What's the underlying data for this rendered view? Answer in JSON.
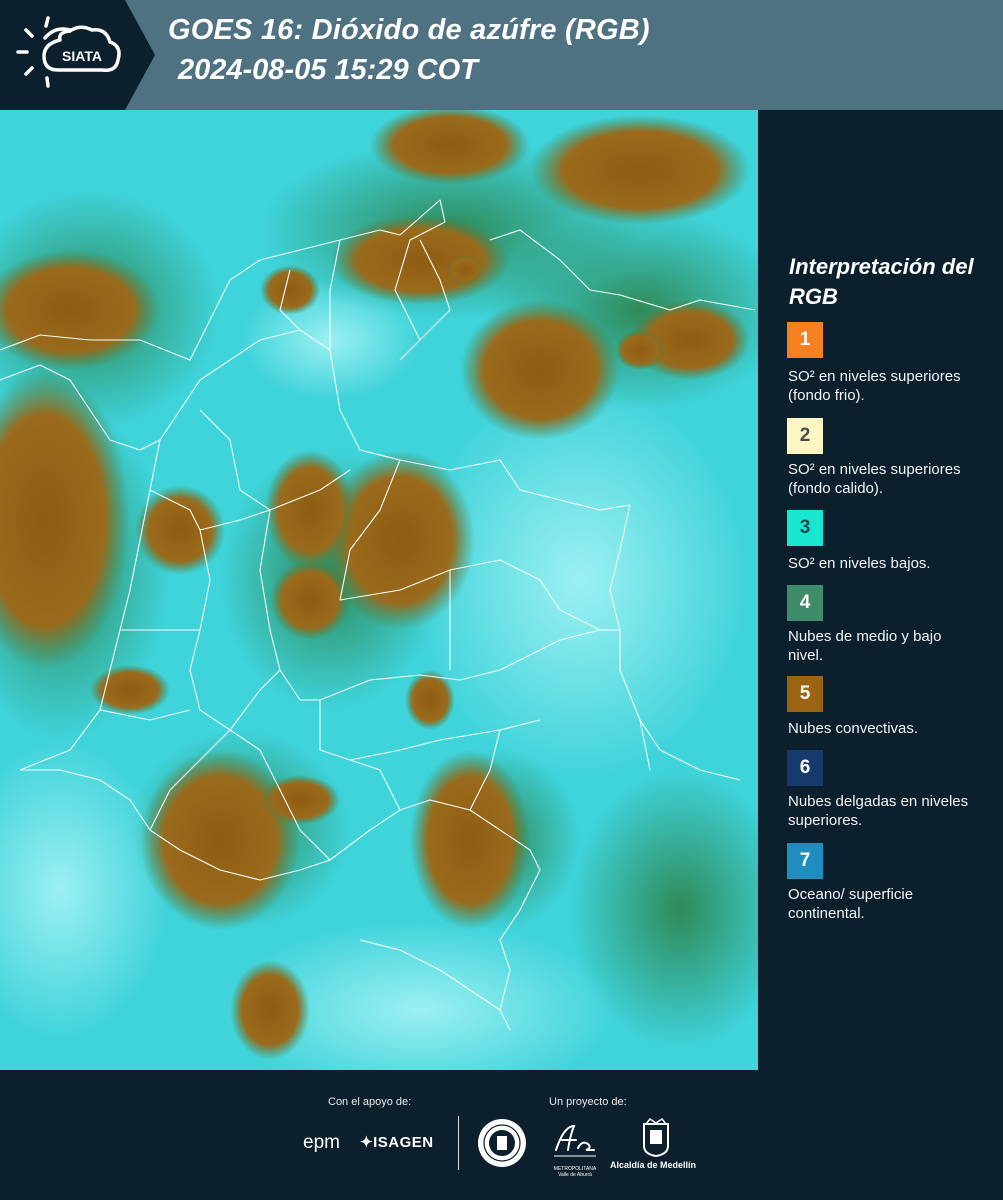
{
  "header": {
    "logo_text": "SIATA",
    "title": "GOES 16: Dióxido de azúfre (RGB)",
    "datetime": "2024-08-05 15:29 COT"
  },
  "legend": {
    "title": "Interpretación del RGB",
    "items": [
      {
        "number": "1",
        "color": "#f5801f",
        "text_color": "#ffffff",
        "label": "SO² en niveles superiores (fondo frio)."
      },
      {
        "number": "2",
        "color": "#fdf6c3",
        "text_color": "#4a4a4a",
        "label": "SO² en niveles superiores (fondo calido)."
      },
      {
        "number": "3",
        "color": "#18e6cf",
        "text_color": "#1d4a4a",
        "label": "SO² en niveles bajos."
      },
      {
        "number": "4",
        "color": "#3f8c6a",
        "text_color": "#ffffff",
        "label": "Nubes de medio y bajo nivel."
      },
      {
        "number": "5",
        "color": "#9a6412",
        "text_color": "#ffffff",
        "label": "Nubes convectivas."
      },
      {
        "number": "6",
        "color": "#153a6b",
        "text_color": "#ffffff",
        "label": "Nubes delgadas en niveles superiores."
      },
      {
        "number": "7",
        "color": "#1f8ebf",
        "text_color": "#ffffff",
        "label": "Oceano/ superficie continental."
      }
    ]
  },
  "footer": {
    "support_label": "Con el apoyo de:",
    "project_label": "Un proyecto de:",
    "sponsors": [
      "epm",
      "ISAGEN"
    ],
    "partners": [
      "Área Metropolitana Valle de Aburrá",
      "Alcaldía de Medellín"
    ],
    "area_caption": "METROPOLITANA Valle de Aburrá",
    "medellin_caption": "Alcaldía de Medellín"
  },
  "colors": {
    "header_bg": "#4e7282",
    "panel_bg": "#0b1f2d",
    "map_cyan": "#3fd6dc",
    "map_cloud_brown": "#9a6412"
  }
}
